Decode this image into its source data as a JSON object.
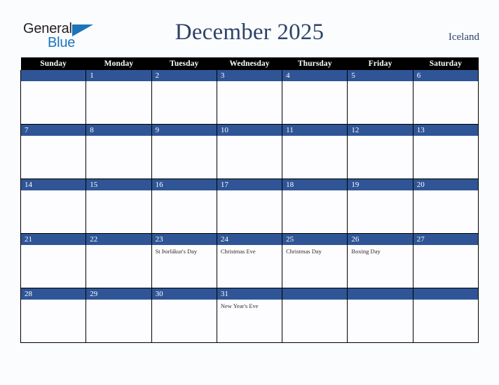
{
  "brand": {
    "name_part1": "General",
    "name_part2": "Blue",
    "triangle_icon": "triangle-icon",
    "color_dark": "#231f20",
    "color_blue": "#1b75bb"
  },
  "header": {
    "title": "December 2025",
    "country": "Iceland",
    "title_color": "#2e4369"
  },
  "theme": {
    "band_blue": "#2f5596",
    "header_black": "#000000",
    "cell_white": "#fdfdff",
    "page_background": "#fbfcfe"
  },
  "calendar": {
    "weekday_headers": [
      "Sunday",
      "Monday",
      "Tuesday",
      "Wednesday",
      "Thursday",
      "Friday",
      "Saturday"
    ],
    "weeks": [
      [
        {
          "day": "",
          "events": []
        },
        {
          "day": "1",
          "events": []
        },
        {
          "day": "2",
          "events": []
        },
        {
          "day": "3",
          "events": []
        },
        {
          "day": "4",
          "events": []
        },
        {
          "day": "5",
          "events": []
        },
        {
          "day": "6",
          "events": []
        }
      ],
      [
        {
          "day": "7",
          "events": []
        },
        {
          "day": "8",
          "events": []
        },
        {
          "day": "9",
          "events": []
        },
        {
          "day": "10",
          "events": []
        },
        {
          "day": "11",
          "events": []
        },
        {
          "day": "12",
          "events": []
        },
        {
          "day": "13",
          "events": []
        }
      ],
      [
        {
          "day": "14",
          "events": []
        },
        {
          "day": "15",
          "events": []
        },
        {
          "day": "16",
          "events": []
        },
        {
          "day": "17",
          "events": []
        },
        {
          "day": "18",
          "events": []
        },
        {
          "day": "19",
          "events": []
        },
        {
          "day": "20",
          "events": []
        }
      ],
      [
        {
          "day": "21",
          "events": []
        },
        {
          "day": "22",
          "events": []
        },
        {
          "day": "23",
          "events": [
            "St Þorlákur's Day"
          ]
        },
        {
          "day": "24",
          "events": [
            "Christmas Eve"
          ]
        },
        {
          "day": "25",
          "events": [
            "Christmas Day"
          ]
        },
        {
          "day": "26",
          "events": [
            "Boxing Day"
          ]
        },
        {
          "day": "27",
          "events": []
        }
      ],
      [
        {
          "day": "28",
          "events": []
        },
        {
          "day": "29",
          "events": []
        },
        {
          "day": "30",
          "events": []
        },
        {
          "day": "31",
          "events": [
            "New Year's Eve"
          ]
        },
        {
          "day": "",
          "events": []
        },
        {
          "day": "",
          "events": []
        },
        {
          "day": "",
          "events": []
        }
      ]
    ]
  }
}
